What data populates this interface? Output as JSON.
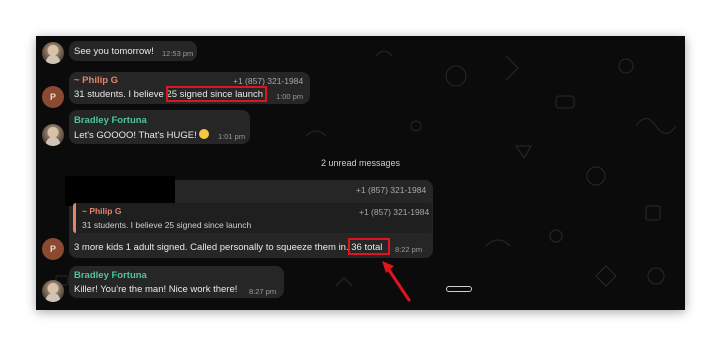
{
  "messages": [
    {
      "text": "See you tomorrow!",
      "time": "12:53 pm"
    },
    {
      "sender": "~ Philip G",
      "phone": "+1 (857) 321-1984",
      "avatar_letter": "P",
      "text_pre": "31 students.  I believe ",
      "text_hl": "25 signed since launch",
      "time": "1:00 pm"
    },
    {
      "sender": "Bradley Fortuna",
      "text": "Let's GOOOO! That's HUGE!",
      "time": "1:01 pm"
    },
    {
      "phone_top": "+1 (857) 321-1984",
      "quote_phone": "+1 (857) 321-1984",
      "quote_sender": "~ Philip G",
      "quote_text": "31 students.  I believe 25 signed since launch",
      "avatar_letter": "P",
      "text_pre": "3 more kids 1 adult signed. Called personally to squeeze them in. ",
      "text_hl": "36 total",
      "time": "8:22 pm"
    },
    {
      "sender": "Bradley Fortuna",
      "text": "Killer! You're the man! Nice work there!",
      "time": "8:27 pm"
    }
  ],
  "unread_label": "2 unread messages",
  "colors": {
    "philip": "#e8836a",
    "bradley": "#4fc3a1",
    "highlight": "#e0141e",
    "background": "#0b0b0b"
  },
  "icons": {
    "emoji": "grinning-face-icon",
    "arrow": "red-arrow-annotation"
  }
}
